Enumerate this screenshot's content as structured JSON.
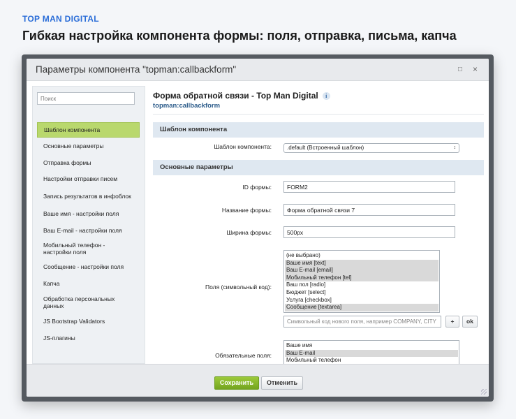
{
  "page": {
    "brand": "TOP MAN DIGITAL",
    "headline": "Гибкая настройка компонента формы: поля, отправка, письма, капча"
  },
  "dialog": {
    "title": "Параметры компонента \"topman:callbackform\"",
    "maximize_icon": "□",
    "close_icon": "×"
  },
  "sidebar": {
    "search_placeholder": "Поиск",
    "items": [
      {
        "label": "Шаблон компонента",
        "active": true
      },
      {
        "label": "Основные параметры"
      },
      {
        "label": "Отправка формы"
      },
      {
        "label": "Настройки отправки писем"
      },
      {
        "label": "Запись результатов в инфоблок"
      },
      {
        "label": "Ваше имя - настройки поля"
      },
      {
        "label": "Ваш E-mail - настройки поля"
      },
      {
        "label": "Мобильный телефон - настройки поля"
      },
      {
        "label": "Сообщение - настройки поля"
      },
      {
        "label": "Капча"
      },
      {
        "label": "Обработка персональных данных"
      },
      {
        "label": "JS Bootstrap Validators"
      },
      {
        "label": "JS-плагины"
      }
    ]
  },
  "content": {
    "title": "Форма обратной связи - Top Man Digital",
    "info_icon": "i",
    "subtitle": "topman:callbackform",
    "section_template": "Шаблон компонента",
    "template_label": "Шаблон компонента:",
    "template_value": ".default (Встроенный шаблон)",
    "section_main": "Основные параметры",
    "form_id_label": "ID формы:",
    "form_id_value": "FORM2",
    "form_name_label": "Название формы:",
    "form_name_value": "Форма обратной связи 7",
    "form_width_label": "Ширина формы:",
    "form_width_value": "500px",
    "fields_label": "Поля (символьный код):",
    "fields_options": [
      {
        "label": "(не выбрано)",
        "selected": false
      },
      {
        "label": "Ваше имя [text]",
        "selected": true
      },
      {
        "label": "Ваш E-mail [email]",
        "selected": true
      },
      {
        "label": "Мобильный телефон [tel]",
        "selected": true
      },
      {
        "label": "Ваш пол [radio]",
        "selected": false
      },
      {
        "label": "Бюджет [select]",
        "selected": false
      },
      {
        "label": "Услуга [checkbox]",
        "selected": false
      },
      {
        "label": "Сообщение [textarea]",
        "selected": true
      }
    ],
    "new_field_placeholder": "Символьный код нового поля, например COMPANY, CITY",
    "plus_label": "+",
    "ok_label": "ok",
    "required_label": "Обязательные поля:",
    "required_options": [
      {
        "label": "Ваше имя",
        "selected": false
      },
      {
        "label": "Ваш E-mail",
        "selected": true
      },
      {
        "label": "Мобильный телефон",
        "selected": false
      }
    ]
  },
  "footer": {
    "save_label": "Сохранить",
    "cancel_label": "Отменить"
  },
  "colors": {
    "brand": "#2a6dd8",
    "active_item": "#b9d86d",
    "save_button": "#7fb02a",
    "section_bg": "#dfe8f1",
    "link": "#2b5b8a"
  }
}
